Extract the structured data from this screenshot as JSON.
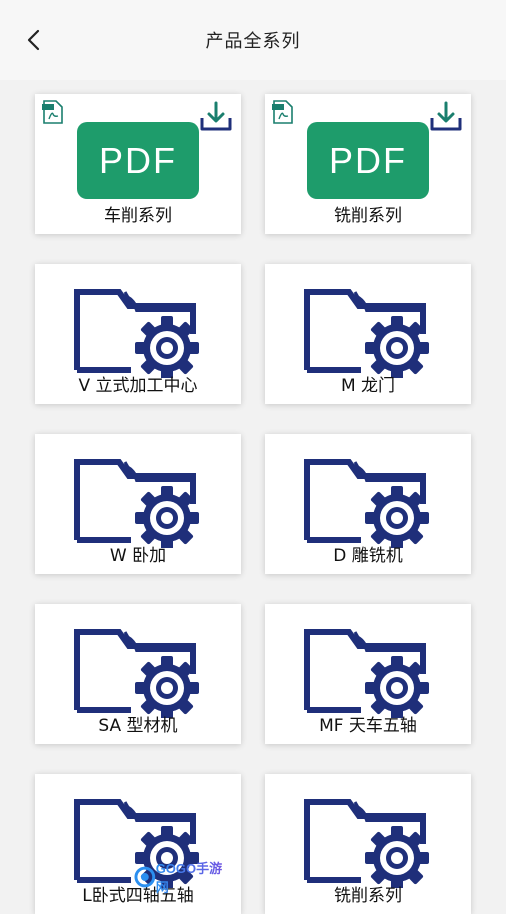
{
  "header": {
    "title": "产品全系列",
    "back_icon": "chevron-left-icon"
  },
  "pdf_badge_text": "PDF",
  "items": [
    {
      "label": "车削系列",
      "type": "pdf"
    },
    {
      "label": "铣削系列",
      "type": "pdf"
    },
    {
      "label": "V 立式加工中心",
      "type": "folder"
    },
    {
      "label": "M 龙门",
      "type": "folder"
    },
    {
      "label": "W 卧加",
      "type": "folder"
    },
    {
      "label": "D 雕铣机",
      "type": "folder"
    },
    {
      "label": "SA 型材机",
      "type": "folder"
    },
    {
      "label": "MF 天车五轴",
      "type": "folder"
    },
    {
      "label": "L卧式四轴五轴",
      "type": "folder"
    },
    {
      "label": "铣削系列",
      "type": "folder"
    }
  ],
  "colors": {
    "pdf_green": "#1e9c6b",
    "folder_navy": "#1f2f7a",
    "download_teal": "#1a7f6e"
  },
  "watermark": {
    "text": "GOGO手游网"
  }
}
